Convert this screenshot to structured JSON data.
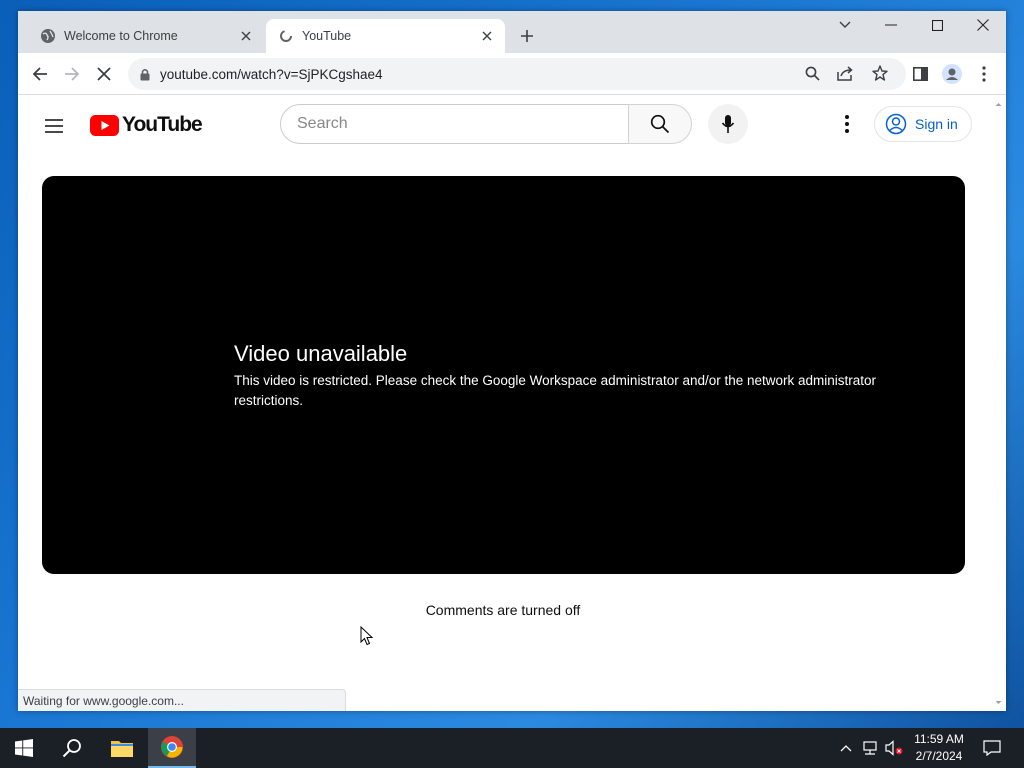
{
  "browser": {
    "tabs": [
      {
        "title": "Welcome to Chrome",
        "icon": "globe-icon",
        "active": false
      },
      {
        "title": "YouTube",
        "icon": "loading-icon",
        "active": true
      }
    ],
    "url": "youtube.com/watch?v=SjPKCgshae4",
    "status_text": "Waiting for www.google.com..."
  },
  "youtube": {
    "logo_text": "YouTube",
    "search_placeholder": "Search",
    "sign_in_label": "Sign in",
    "error_title": "Video unavailable",
    "error_message": "This video is restricted. Please check the Google Workspace administrator and/or the network administrator restrictions.",
    "comments_status": "Comments are turned off"
  },
  "taskbar": {
    "time": "11:59 AM",
    "date": "2/7/2024"
  },
  "colors": {
    "youtube_red": "#FF0000",
    "link_blue": "#065fd4",
    "player_bg": "#000000"
  }
}
